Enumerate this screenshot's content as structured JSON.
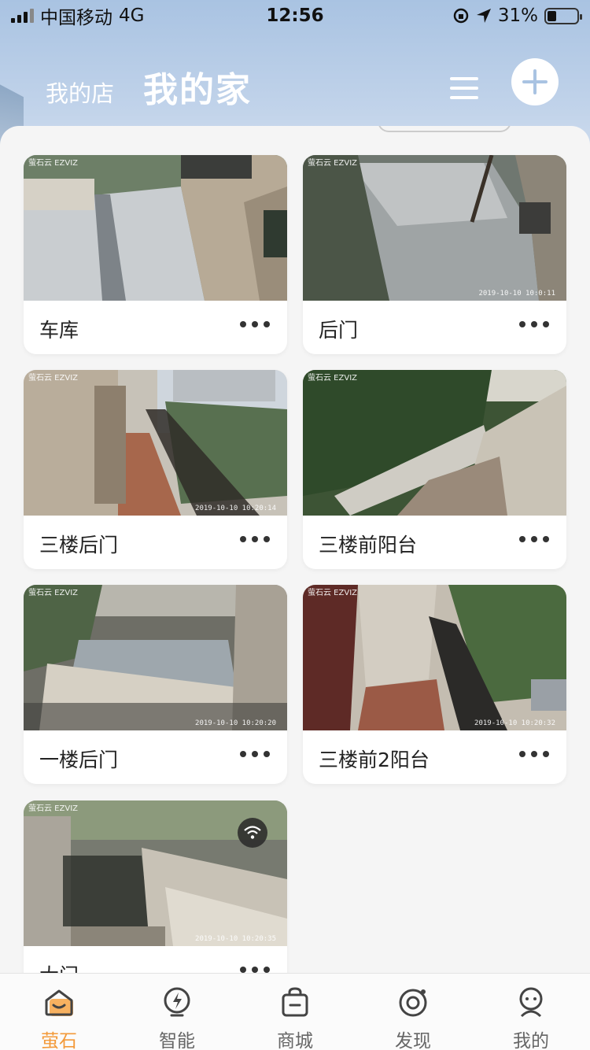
{
  "status_bar": {
    "carrier": "中国移动",
    "network": "4G",
    "time": "12:56",
    "battery": "31%",
    "battery_level": 0.31
  },
  "header": {
    "tab_shop": "我的店",
    "tab_home": "我的家",
    "menu_icon": "hamburger-menu-icon",
    "add_icon": "plus-icon"
  },
  "devices": [
    {
      "name": "车库",
      "timestamp": ""
    },
    {
      "name": "后门",
      "timestamp": "2019-10-10 10:0:11"
    },
    {
      "name": "三楼后门",
      "timestamp": "2019-10-10 10:20:14"
    },
    {
      "name": "三楼前阳台",
      "timestamp": ""
    },
    {
      "name": "一楼后门",
      "timestamp": "2019-10-10 10:20:20"
    },
    {
      "name": "三楼前2阳台",
      "timestamp": "2019-10-10 10:20:32"
    },
    {
      "name": "大门",
      "timestamp": "2019-10-10 10:20:35"
    }
  ],
  "camera_logo": "萤石云 EZVIZ",
  "bottom_nav": [
    {
      "label": "萤石",
      "icon": "home-icon",
      "active": true
    },
    {
      "label": "智能",
      "icon": "lightning-icon",
      "active": false
    },
    {
      "label": "商城",
      "icon": "shopping-bag-icon",
      "active": false
    },
    {
      "label": "发现",
      "icon": "discover-icon",
      "active": false
    },
    {
      "label": "我的",
      "icon": "profile-icon",
      "active": false
    }
  ],
  "colors": {
    "accent": "#f39a3a",
    "header_gradient_top": "#a9c3e2",
    "background": "#f5f5f5"
  }
}
